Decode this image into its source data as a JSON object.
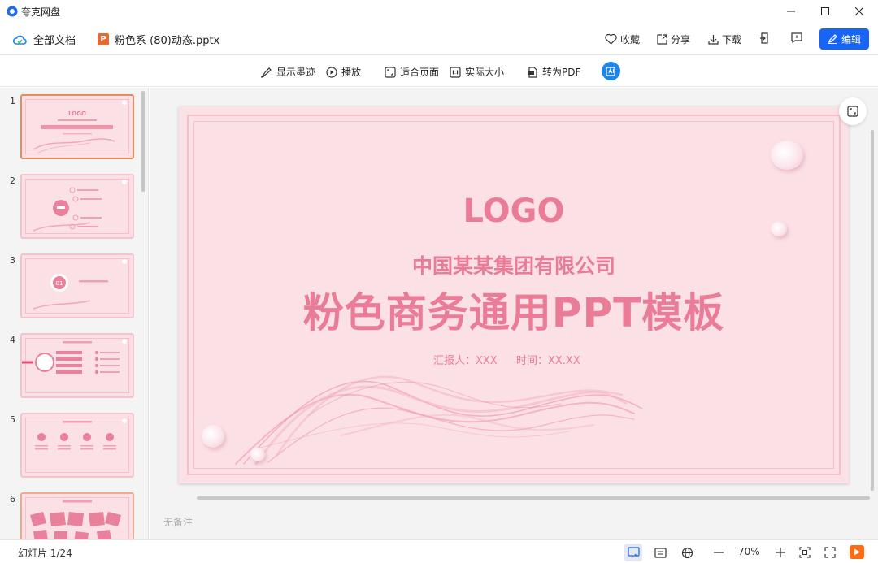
{
  "window": {
    "app_title": "夸克网盘",
    "controls": [
      "minimize",
      "maximize",
      "close"
    ]
  },
  "docbar": {
    "all_docs_label": "全部文档",
    "file_icon_letter": "P",
    "file_name": "粉色系 (80)动态.pptx",
    "actions": {
      "favorite": "收藏",
      "share": "分享",
      "download": "下载"
    },
    "edit_label": "编辑"
  },
  "toolbar": {
    "ink": "显示墨迹",
    "play": "播放",
    "fit_page": "适合页面",
    "actual_size": "实际大小",
    "to_pdf": "转为PDF"
  },
  "sidebar": {
    "slide_numbers": [
      "1",
      "2",
      "3",
      "4",
      "5",
      "6"
    ],
    "selected": 1
  },
  "slide": {
    "logo": "LOGO",
    "company": "中国某某集团有限公司",
    "title": "粉色商务通用PPT模板",
    "reporter": "汇报人：XXX",
    "time": "时间：XX.XX"
  },
  "notes_placeholder": "无备注",
  "statusbar": {
    "slide_count": "幻灯片 1/24",
    "zoom": "70%"
  },
  "colors": {
    "accent": "#1764f5",
    "slide_pink": "#fbe0e5",
    "slide_text": "#ea7c98",
    "selected_thumb": "#e98a5b",
    "play_orange": "#ff6a14"
  }
}
